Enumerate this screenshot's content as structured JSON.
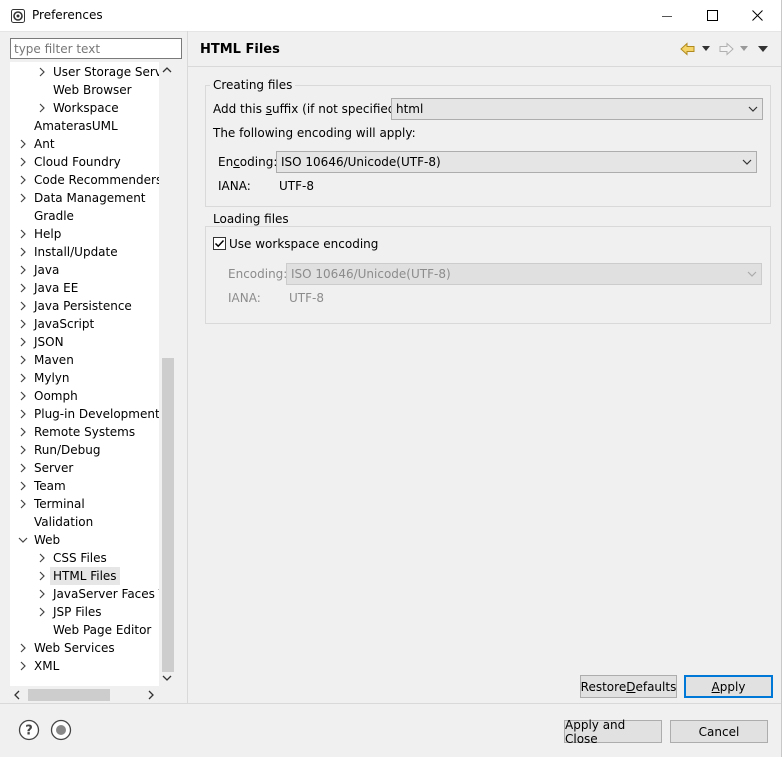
{
  "window": {
    "title": "Preferences"
  },
  "filter": {
    "placeholder": "type filter text"
  },
  "tree": [
    {
      "label": "User Storage Servic",
      "indent": 2,
      "chevron": "right"
    },
    {
      "label": "Web Browser",
      "indent": 2,
      "chevron": ""
    },
    {
      "label": "Workspace",
      "indent": 2,
      "chevron": "right"
    },
    {
      "label": "AmaterasUML",
      "indent": 1,
      "chevron": ""
    },
    {
      "label": "Ant",
      "indent": 1,
      "chevron": "right"
    },
    {
      "label": "Cloud Foundry",
      "indent": 1,
      "chevron": "right"
    },
    {
      "label": "Code Recommenders",
      "indent": 1,
      "chevron": "right"
    },
    {
      "label": "Data Management",
      "indent": 1,
      "chevron": "right"
    },
    {
      "label": "Gradle",
      "indent": 1,
      "chevron": ""
    },
    {
      "label": "Help",
      "indent": 1,
      "chevron": "right"
    },
    {
      "label": "Install/Update",
      "indent": 1,
      "chevron": "right"
    },
    {
      "label": "Java",
      "indent": 1,
      "chevron": "right"
    },
    {
      "label": "Java EE",
      "indent": 1,
      "chevron": "right"
    },
    {
      "label": "Java Persistence",
      "indent": 1,
      "chevron": "right"
    },
    {
      "label": "JavaScript",
      "indent": 1,
      "chevron": "right"
    },
    {
      "label": "JSON",
      "indent": 1,
      "chevron": "right"
    },
    {
      "label": "Maven",
      "indent": 1,
      "chevron": "right"
    },
    {
      "label": "Mylyn",
      "indent": 1,
      "chevron": "right"
    },
    {
      "label": "Oomph",
      "indent": 1,
      "chevron": "right"
    },
    {
      "label": "Plug-in Development",
      "indent": 1,
      "chevron": "right"
    },
    {
      "label": "Remote Systems",
      "indent": 1,
      "chevron": "right"
    },
    {
      "label": "Run/Debug",
      "indent": 1,
      "chevron": "right"
    },
    {
      "label": "Server",
      "indent": 1,
      "chevron": "right"
    },
    {
      "label": "Team",
      "indent": 1,
      "chevron": "right"
    },
    {
      "label": "Terminal",
      "indent": 1,
      "chevron": "right"
    },
    {
      "label": "Validation",
      "indent": 1,
      "chevron": ""
    },
    {
      "label": "Web",
      "indent": 1,
      "chevron": "down"
    },
    {
      "label": "CSS Files",
      "indent": 2,
      "chevron": "right"
    },
    {
      "label": "HTML Files",
      "indent": 2,
      "chevron": "right",
      "selected": true
    },
    {
      "label": "JavaServer Faces To",
      "indent": 2,
      "chevron": "right"
    },
    {
      "label": "JSP Files",
      "indent": 2,
      "chevron": "right"
    },
    {
      "label": "Web Page Editor",
      "indent": 2,
      "chevron": ""
    },
    {
      "label": "Web Services",
      "indent": 1,
      "chevron": "right"
    },
    {
      "label": "XML",
      "indent": 1,
      "chevron": "right"
    }
  ],
  "page": {
    "title": "HTML Files",
    "creating": {
      "legend": "Creating files",
      "suffix_label_pre": "Add this ",
      "suffix_label_mn": "s",
      "suffix_label_post": "uffix (if not specified):",
      "suffix_value": "html",
      "encoding_note": "The following encoding will apply:",
      "encoding_label_pre": "En",
      "encoding_label_mn": "c",
      "encoding_label_post": "oding:",
      "encoding_value": "ISO 10646/Unicode(UTF-8)",
      "iana_label": "IANA:",
      "iana_value": "UTF-8"
    },
    "loading": {
      "legend": "Loading files",
      "checkbox_label": "Use workspace encoding",
      "checkbox_checked": true,
      "encoding_label": "Encoding:",
      "encoding_value": "ISO 10646/Unicode(UTF-8)",
      "iana_label": "IANA:",
      "iana_value": "UTF-8"
    }
  },
  "buttons": {
    "restore_pre": "Restore ",
    "restore_mn": "D",
    "restore_post": "efaults",
    "apply_mn": "A",
    "apply_post": "pply",
    "apply_close": "Apply and Close",
    "cancel": "Cancel"
  }
}
